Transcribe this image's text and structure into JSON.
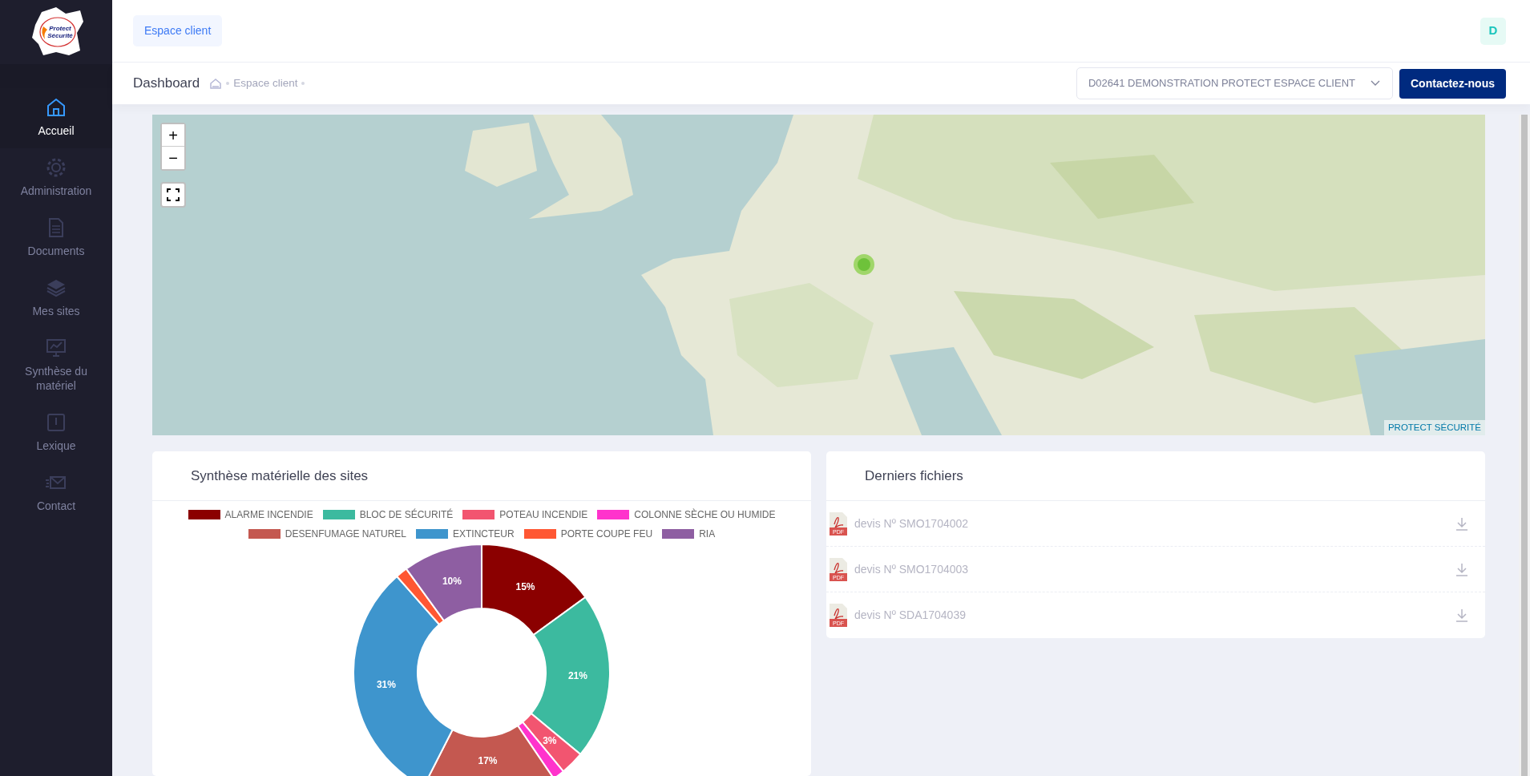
{
  "sidebar": {
    "logo_text": "Protect Sécurité",
    "items": [
      {
        "label": "Accueil",
        "selected": true
      },
      {
        "label": "Administration",
        "selected": false
      },
      {
        "label": "Documents",
        "selected": false
      },
      {
        "label": "Mes sites",
        "selected": false
      },
      {
        "label": "Synthèse du matériel",
        "selected": false
      },
      {
        "label": "Lexique",
        "selected": false
      },
      {
        "label": "Contact",
        "selected": false
      }
    ]
  },
  "header": {
    "tab": "Espace client",
    "avatar": "D"
  },
  "breadcrumb": {
    "title": "Dashboard",
    "items": [
      "Espace client"
    ]
  },
  "account_select": {
    "value": "D02641 DEMONSTRATION PROTECT ESPACE CLIENT"
  },
  "contact_button": "Contactez-nous",
  "map": {
    "kind": "picture",
    "zoom_in": "+",
    "zoom_out": "−",
    "attribution": "PROTECT SÉCURITÉ"
  },
  "chart_card": {
    "title": "Synthèse matérielle des sites",
    "chart_data": {
      "type": "donut",
      "value_labels": [
        "15%",
        "21%",
        "3%",
        null,
        "17%",
        "31%",
        null,
        "10%"
      ],
      "categories": [
        "ALARME INCENDIE",
        "BLOC DE SÉCURITÉ",
        "POTEAU INCENDIE",
        "COLONNE SÈCHE OU HUMIDE",
        "DESENFUMAGE NATUREL",
        "EXTINCTEUR",
        "PORTE COUPE FEU",
        "RIA"
      ],
      "colors": [
        "#8b0000",
        "#3cba9f",
        "#f25570",
        "#ff33cc",
        "#c45850",
        "#3e95cd",
        "#ff5733",
        "#8e5ea2"
      ],
      "values": [
        15,
        21,
        3,
        1.5,
        17,
        31,
        1.5,
        10
      ]
    }
  },
  "files_card": {
    "title": "Derniers fichiers",
    "files": [
      {
        "name": "devis Nº SMO1704002",
        "badge": "PDF"
      },
      {
        "name": "devis Nº SMO1704003",
        "badge": "PDF"
      },
      {
        "name": "devis Nº SDA1704039",
        "badge": "PDF"
      }
    ]
  }
}
